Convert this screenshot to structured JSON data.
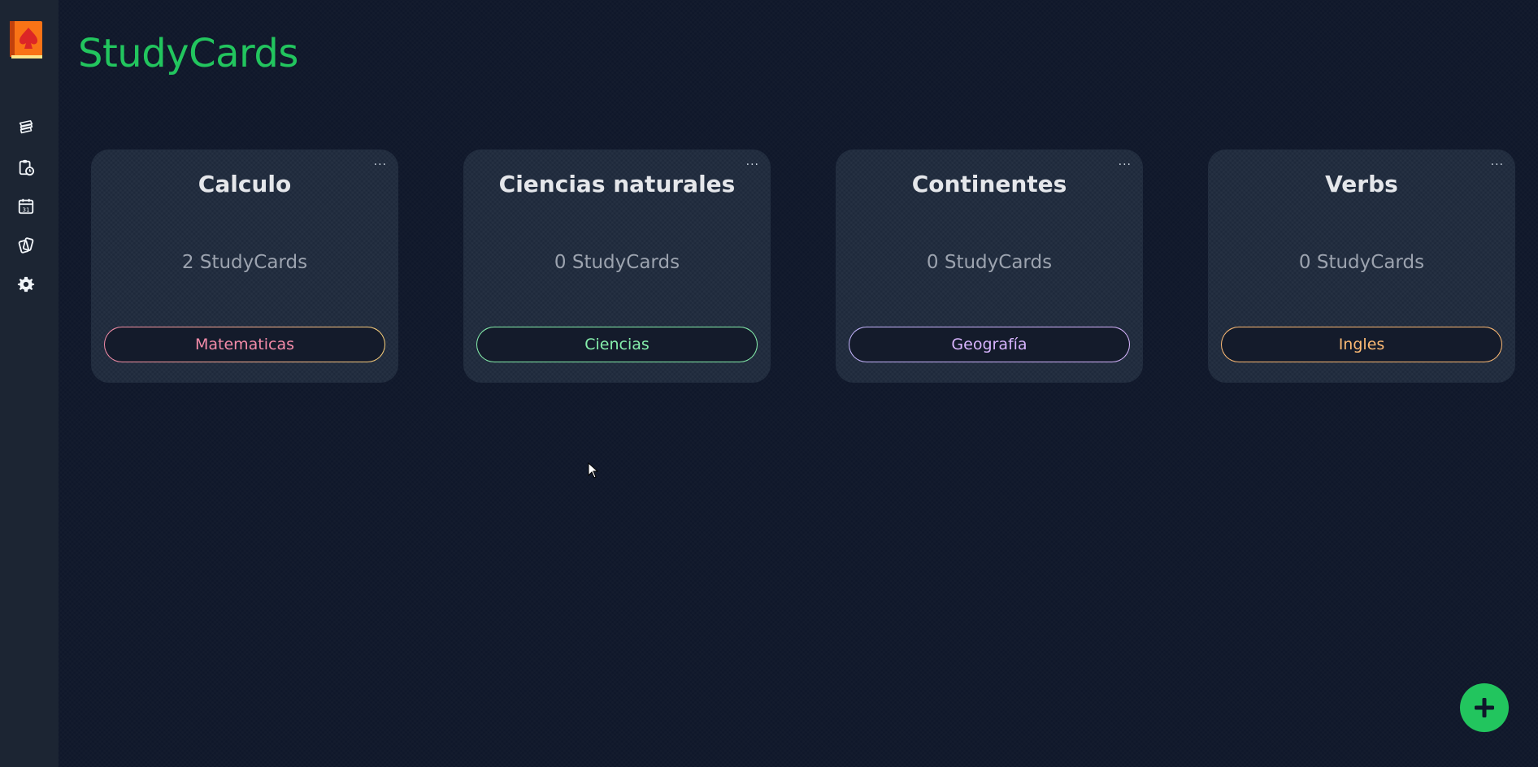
{
  "app": {
    "title": "StudyCards"
  },
  "sidebar": {
    "items": [
      {
        "name": "notes-icon"
      },
      {
        "name": "clipboard-clock-icon"
      },
      {
        "name": "calendar-icon",
        "label": "31"
      },
      {
        "name": "cards-icon"
      },
      {
        "name": "gear-icon"
      }
    ]
  },
  "decks": [
    {
      "title": "Calculo",
      "count": "2 StudyCards",
      "menu": "...",
      "tag": "Matematicas",
      "tag_color": "#f38ba8",
      "tag_border_from": "#f38ba8",
      "tag_border_to": "#f9d07a"
    },
    {
      "title": "Ciencias naturales",
      "count": "0 StudyCards",
      "menu": "...",
      "tag": "Ciencias",
      "tag_color": "#86efac",
      "tag_border_from": "#86efac",
      "tag_border_to": "#86efac"
    },
    {
      "title": "Continentes",
      "count": "0 StudyCards",
      "menu": "...",
      "tag": "Geografía",
      "tag_color": "#d8b4fe",
      "tag_border_from": "#c4b5fd",
      "tag_border_to": "#d8b4fe"
    },
    {
      "title": "Verbs",
      "count": "0 StudyCards",
      "menu": "...",
      "tag": "Ingles",
      "tag_color": "#fdba74",
      "tag_border_from": "#fdba74",
      "tag_border_to": "#fdba74"
    }
  ],
  "fab": {
    "icon": "plus-icon",
    "color": "#22c55e"
  }
}
